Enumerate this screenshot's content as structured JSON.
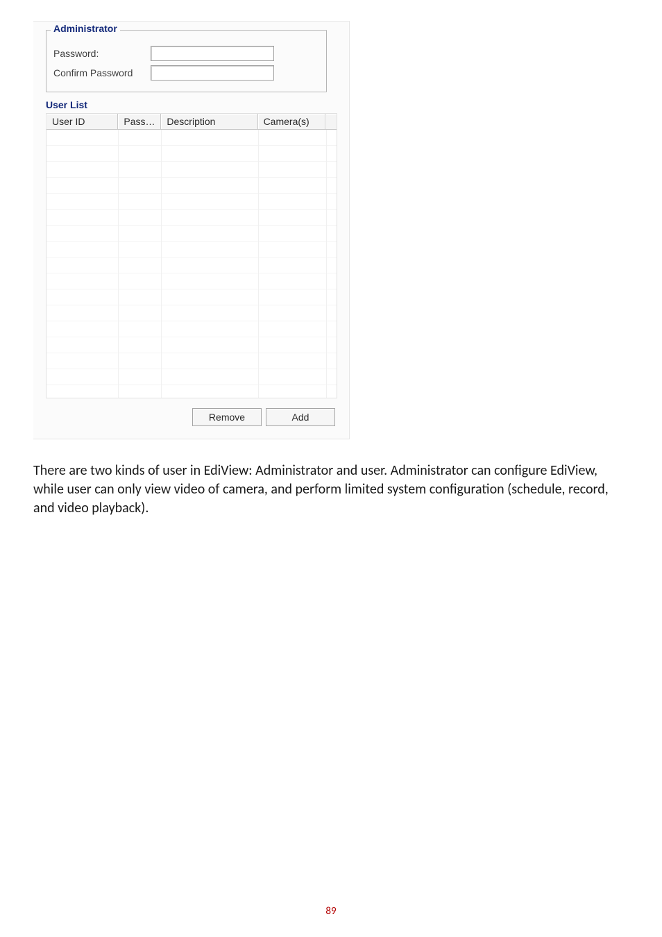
{
  "admin": {
    "legend": "Administrator",
    "password_label": "Password:",
    "confirm_label": "Confirm Password",
    "password_value": "",
    "confirm_value": ""
  },
  "userlist": {
    "heading": "User List",
    "columns": {
      "c1": "User ID",
      "c2": "Pass…",
      "c3": "Description",
      "c4": "Camera(s)"
    }
  },
  "buttons": {
    "remove": "Remove",
    "add": "Add"
  },
  "body_text": "There are two kinds of user in EdiView: Administrator and user. Administrator can configure EdiView, while user can only view video of camera, and perform limited system configuration (schedule, record, and video playback).",
  "page_number": "89"
}
